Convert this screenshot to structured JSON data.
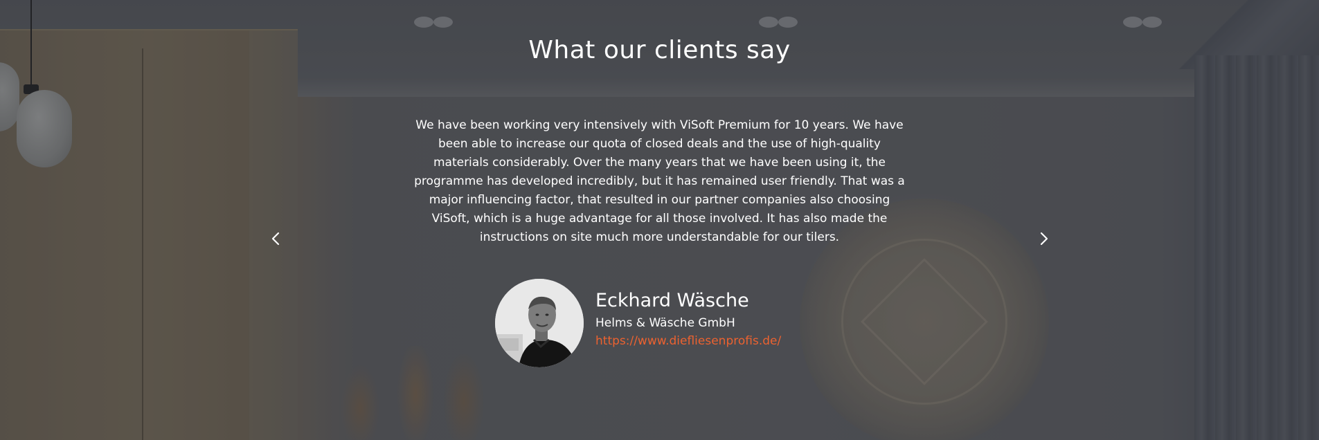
{
  "testimonials": {
    "heading": "What our clients say",
    "quote": "We have been working very intensively with ViSoft Premium for 10 years. We have been able to increase our quota of closed deals and the use of high-quality materials considerably. Over the many years that we have been using it, the programme has developed incredibly, but it has remained user friendly. That was a major influencing factor, that resulted in our partner companies also choosing ViSoft, which is a huge advantage for all those involved. It has also made the instructions on site much more understandable for our tilers.",
    "author": {
      "name": "Eckhard Wäsche",
      "company": "Helms & Wäsche GmbH",
      "url": "https://www.diefliesenprofis.de/"
    },
    "prev_icon": "chevron-left-icon",
    "next_icon": "chevron-right-icon"
  },
  "colors": {
    "text": "#ffffff",
    "link": "#ec6230"
  }
}
